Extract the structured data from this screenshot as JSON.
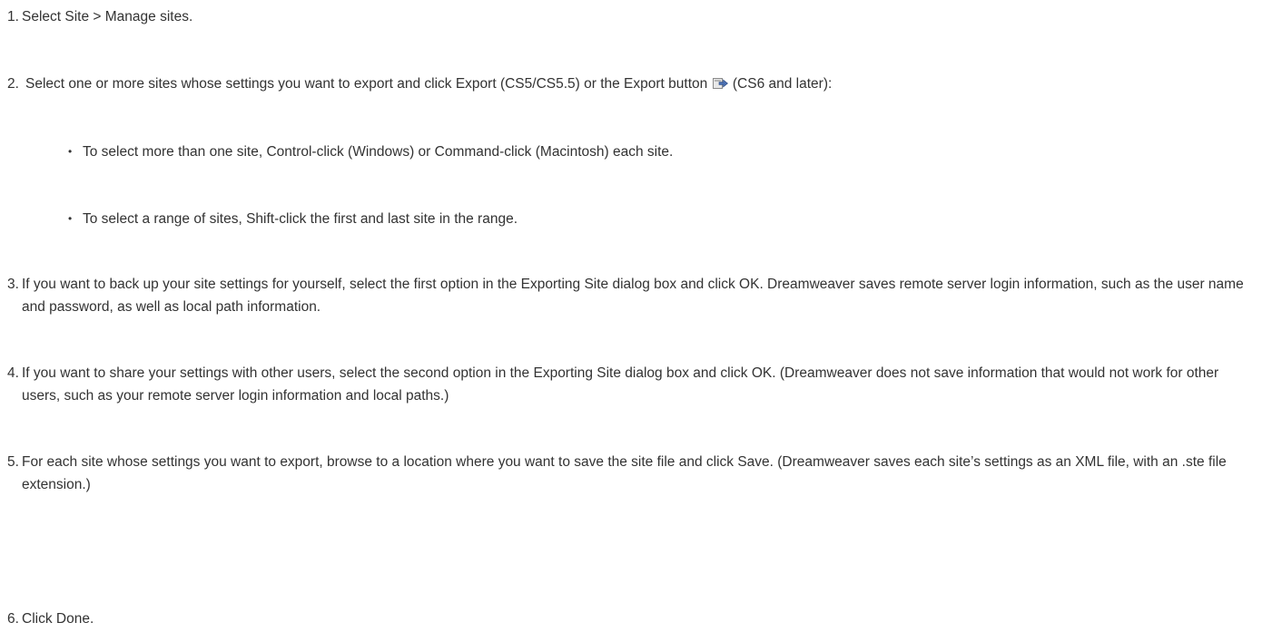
{
  "steps": [
    {
      "num": "1.",
      "text": "Select Site > Manage sites."
    },
    {
      "num": "2.",
      "text_before": "Select one or more sites whose settings you want to export and click Export (CS5/CS5.5) or the Export button",
      "icon": "export-site-icon",
      "text_after": "(CS6 and later):"
    },
    {
      "num": "3.",
      "text": "If you want to back up your site settings for yourself, select the first option in the Exporting Site dialog box and click OK. Dreamweaver saves remote server login information, such as the user name and password, as well as local path information."
    },
    {
      "num": "4.",
      "text": "If you want to share your settings with other users, select the second option in the Exporting Site dialog box and click OK. (Dreamweaver does not save information that would not work for other users, such as your remote server login information and local paths.)"
    },
    {
      "num": "5.",
      "text": "For each site whose settings you want to export, browse to a location where you want to save the site file and click Save. (Dreamweaver saves each site’s settings as an XML file, with an .ste file extension.)"
    },
    {
      "num": "6.",
      "text": "Click Done."
    }
  ],
  "bullets": [
    {
      "dot": "•",
      "text": "To select more than one site, Control-click (Windows) or Command-click (Macintosh) each site."
    },
    {
      "dot": "•",
      "text": "To select a range of sites, Shift-click the first and last site in the range."
    }
  ]
}
